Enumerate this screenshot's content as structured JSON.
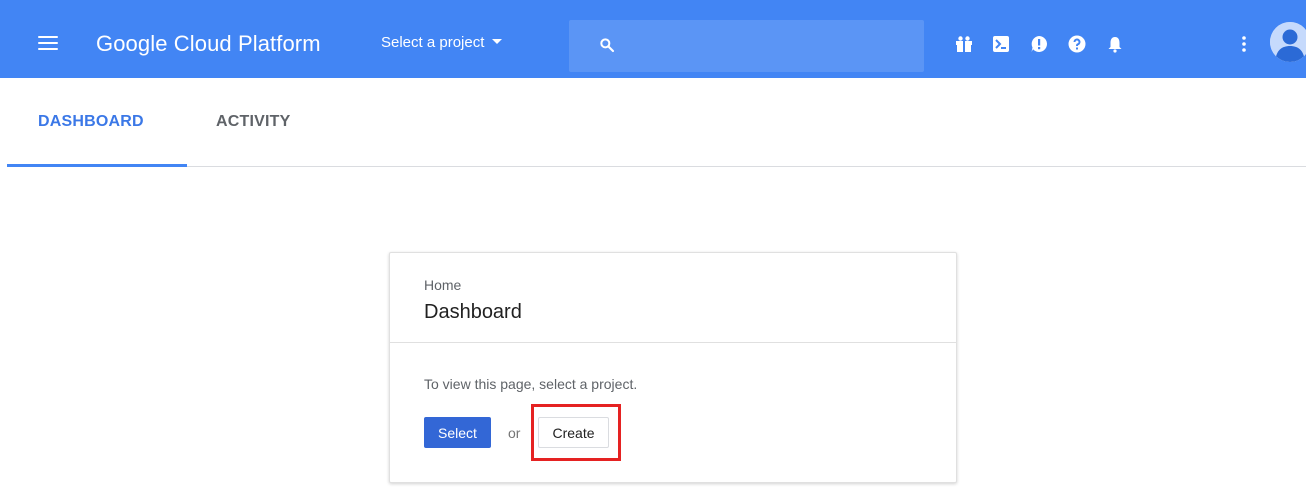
{
  "header": {
    "brand": "Google Cloud Platform",
    "project_select_label": "Select a project",
    "search_placeholder": "",
    "icons": [
      "menu-icon",
      "search-icon",
      "gift-icon",
      "cloud-shell-icon",
      "feedback-icon",
      "help-icon",
      "notifications-icon",
      "more-vert-icon",
      "account-avatar"
    ],
    "colors": {
      "bar": "#4285f4",
      "search_bg": "#5b95f5"
    }
  },
  "tabs": [
    {
      "label": "DASHBOARD",
      "active": true
    },
    {
      "label": "ACTIVITY",
      "active": false
    }
  ],
  "card": {
    "breadcrumb": "Home",
    "title": "Dashboard",
    "message": "To view this page, select a project.",
    "select_label": "Select",
    "or_label": "or",
    "create_label": "Create",
    "highlight_color": "#e52222"
  }
}
